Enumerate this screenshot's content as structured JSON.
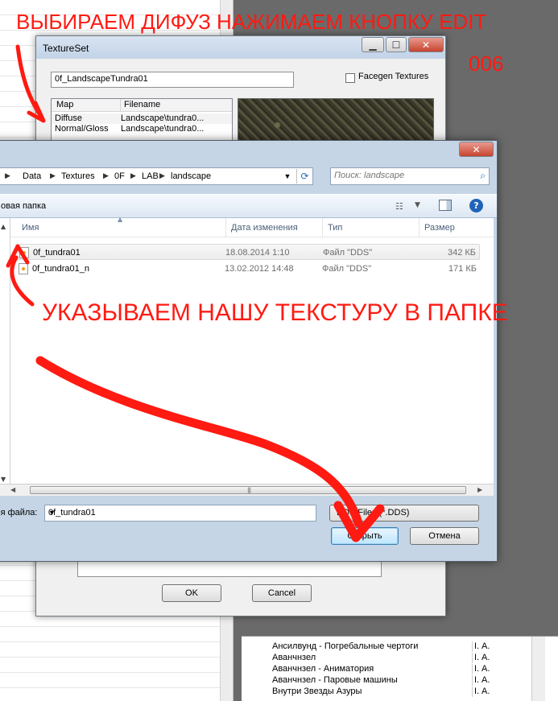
{
  "annotations": {
    "top": "ВЫБИРАЕМ ДИФУЗ  НАЖИМАЕМ КНОПКУ EDIT",
    "num": "006",
    "middle": "УКАЗЫВАЕМ НАШУ ТЕКСТУРУ В ПАПКЕ",
    "color": "#ff1a12"
  },
  "texture_dialog": {
    "title": "TextureSet",
    "name_value": "0f_LandscapeTundra01",
    "facegen_label": "Facegen Textures",
    "columns": [
      "Map",
      "Filename"
    ],
    "maps": [
      {
        "map": "Diffuse",
        "file": "Landscape\\tundra0..."
      },
      {
        "map": "Normal/Gloss",
        "file": "Landscape\\tundra0..."
      }
    ],
    "ok_label": "OK",
    "cancel_label": "Cancel"
  },
  "file_dialog": {
    "breadcrumb": [
      "Data",
      "Textures",
      "0F",
      "LAB",
      "landscape"
    ],
    "search_placeholder": "Поиск: landscape",
    "new_folder": "овая папка",
    "columns": {
      "name": "Имя",
      "date": "Дата изменения",
      "type": "Тип",
      "size": "Размер"
    },
    "files": [
      {
        "name": "0f_tundra01",
        "date": "18.08.2014 1:10",
        "type": "Файл \"DDS\"",
        "size": "342 КБ"
      },
      {
        "name": "0f_tundra01_n",
        "date": "13.02.2012 14:48",
        "type": "Файл \"DDS\"",
        "size": "171 КБ"
      }
    ],
    "filename_label": "мя файла:",
    "filename_value": "0f_tundra01",
    "filter_value": "DDS Files (*.DDS)",
    "open_label": "Открыть",
    "cancel_label": "Отмена"
  },
  "bottom_list": {
    "rows": [
      {
        "name": "Ансилвунд - Погребальные чертоги",
        "a": "I.",
        "b": "A."
      },
      {
        "name": "Аванчнзел",
        "a": "I.",
        "b": "A."
      },
      {
        "name": "Аванчнзел - Аниматория",
        "a": "I.",
        "b": "A."
      },
      {
        "name": "Аванчнзел - Паровые машины",
        "a": "I.",
        "b": "A."
      },
      {
        "name": "Внутри Звезды Азуры",
        "a": "I.",
        "b": "A."
      }
    ]
  }
}
